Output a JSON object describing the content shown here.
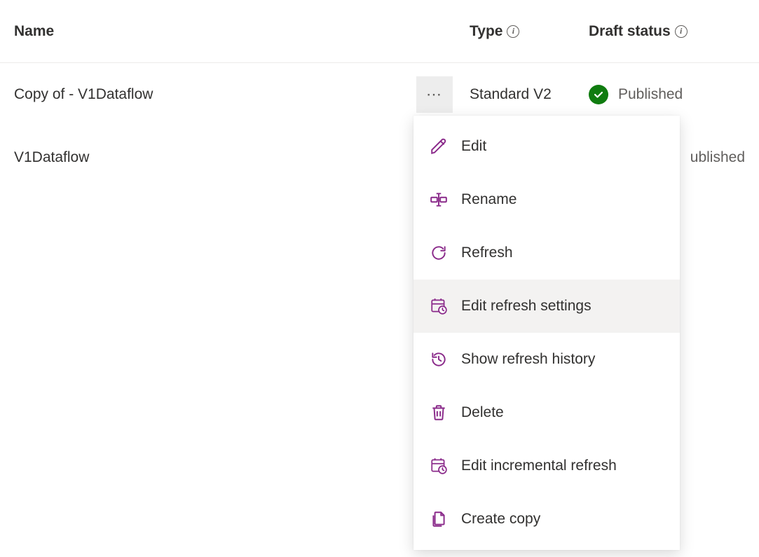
{
  "columns": {
    "name": "Name",
    "type": "Type",
    "draft_status": "Draft status"
  },
  "rows": [
    {
      "name": "Copy of - V1Dataflow",
      "type": "Standard V2",
      "draft_status": "Published"
    },
    {
      "name": "V1Dataflow",
      "type": "",
      "draft_status": "ublished"
    }
  ],
  "menu": {
    "edit": "Edit",
    "rename": "Rename",
    "refresh": "Refresh",
    "edit_refresh_settings": "Edit refresh settings",
    "show_refresh_history": "Show refresh history",
    "delete": "Delete",
    "edit_incremental_refresh": "Edit incremental refresh",
    "create_copy": "Create copy"
  }
}
